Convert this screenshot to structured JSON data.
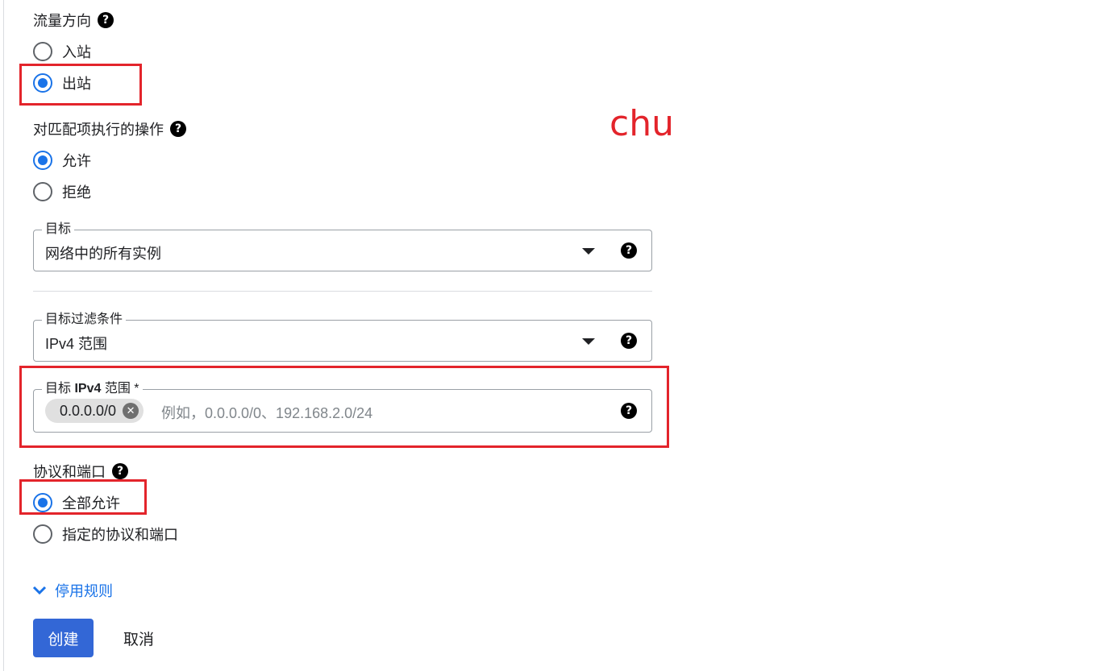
{
  "traffic_direction": {
    "title": "流量方向",
    "options": [
      {
        "label": "入站",
        "checked": false
      },
      {
        "label": "出站",
        "checked": true
      }
    ]
  },
  "annotation_text": "chu",
  "action_on_match": {
    "title": "对匹配项执行的操作",
    "options": [
      {
        "label": "允许",
        "checked": true
      },
      {
        "label": "拒绝",
        "checked": false
      }
    ]
  },
  "target": {
    "label": "目标",
    "value": "网络中的所有实例"
  },
  "target_filter": {
    "label": "目标过滤条件",
    "value": "IPv4 范围"
  },
  "target_ipv4": {
    "label_prefix": "目标 ",
    "label_bold": "IPv4",
    "label_suffix": " 范围 *",
    "chip": "0.0.0.0/0",
    "placeholder": "例如，0.0.0.0/0、192.168.2.0/24"
  },
  "protocols_ports": {
    "title": "协议和端口",
    "options": [
      {
        "label": "全部允许",
        "checked": true
      },
      {
        "label": "指定的协议和端口",
        "checked": false
      }
    ]
  },
  "disable_rule_link": "停用规则",
  "buttons": {
    "create": "创建",
    "cancel": "取消"
  },
  "colors": {
    "accent": "#1a73e8",
    "primary_button": "#3367d6",
    "annotation_red": "#e3242b"
  }
}
